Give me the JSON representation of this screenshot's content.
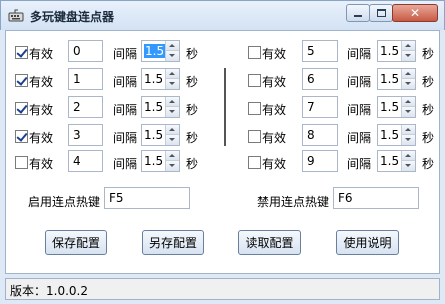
{
  "window": {
    "title": "多玩键盘连点器",
    "icon": "keyboard-icon",
    "controls": {
      "minimize": "minimize-icon",
      "maximize": "maximize-icon",
      "close": "close-icon"
    }
  },
  "common": {
    "valid_label": "有效",
    "interval_label": "间隔",
    "unit_label": "秒"
  },
  "left_rows": [
    {
      "checked": true,
      "key": "0",
      "interval": "1.5",
      "selected": true
    },
    {
      "checked": true,
      "key": "1",
      "interval": "1.5"
    },
    {
      "checked": true,
      "key": "2",
      "interval": "1.5"
    },
    {
      "checked": true,
      "key": "3",
      "interval": "1.5"
    },
    {
      "checked": false,
      "key": "4",
      "interval": "1.5"
    }
  ],
  "right_rows": [
    {
      "checked": false,
      "key": "5",
      "interval": "1.5"
    },
    {
      "checked": false,
      "key": "6",
      "interval": "1.5"
    },
    {
      "checked": false,
      "key": "7",
      "interval": "1.5"
    },
    {
      "checked": false,
      "key": "8",
      "interval": "1.5"
    },
    {
      "checked": false,
      "key": "9",
      "interval": "1.5"
    }
  ],
  "hotkeys": {
    "enable_label": "启用连点热键",
    "enable_value": "F5",
    "disable_label": "禁用连点热键",
    "disable_value": "F6"
  },
  "buttons": {
    "save": "保存配置",
    "save_as": "另存配置",
    "load": "读取配置",
    "help": "使用说明"
  },
  "status": {
    "version_text": "版本：1.0.0.2"
  }
}
